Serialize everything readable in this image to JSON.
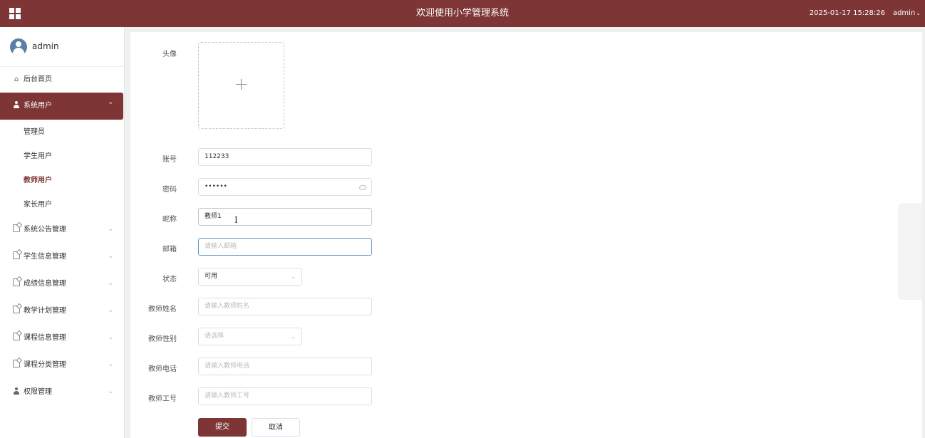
{
  "header": {
    "title": "欢迎使用小学管理系统",
    "datetime": "2025-01-17 15:28:26",
    "user": "admin",
    "caret": "⌄"
  },
  "sidebar": {
    "username": "admin",
    "items": [
      {
        "label": "后台首页",
        "icon": "home-icon",
        "glyph": "⌂"
      },
      {
        "label": "系统用户",
        "icon": "person-icon",
        "arrow": "⌃"
      },
      {
        "label": "系统公告管理",
        "icon": "doc-icon",
        "arrow": "⌄"
      },
      {
        "label": "学生信息管理",
        "icon": "doc-icon",
        "arrow": "⌄"
      },
      {
        "label": "成绩信息管理",
        "icon": "doc-icon",
        "arrow": "⌄"
      },
      {
        "label": "教学计划管理",
        "icon": "doc-icon",
        "arrow": "⌄"
      },
      {
        "label": "课程信息管理",
        "icon": "doc-icon",
        "arrow": "⌄"
      },
      {
        "label": "课程分类管理",
        "icon": "doc-icon",
        "arrow": "⌄"
      },
      {
        "label": "权限管理",
        "icon": "person-icon",
        "arrow": "⌄"
      }
    ],
    "sub_items": [
      "管理员",
      "学生用户",
      "教师用户",
      "家长用户"
    ]
  },
  "form": {
    "avatar_label": "头像",
    "upload_plus": "+",
    "account_label": "账号",
    "account_value": "112233",
    "password_label": "密码",
    "password_value": "••••••",
    "nickname_label": "昵称",
    "nickname_value": "教师1",
    "email_label": "邮箱",
    "email_placeholder": "请输入邮箱",
    "status_label": "状态",
    "status_value": "可用",
    "teacher_name_label": "教师姓名",
    "teacher_name_placeholder": "请输入教师姓名",
    "teacher_gender_label": "教师性别",
    "teacher_gender_placeholder": "请选择",
    "teacher_phone_label": "教师电话",
    "teacher_phone_placeholder": "请输入教师电话",
    "teacher_no_label": "教师工号",
    "teacher_no_placeholder": "请输入教师工号",
    "submit_label": "提交",
    "cancel_label": "取消"
  },
  "colors": {
    "brand": "#7d3536",
    "focus_border": "#6a9cd2"
  }
}
